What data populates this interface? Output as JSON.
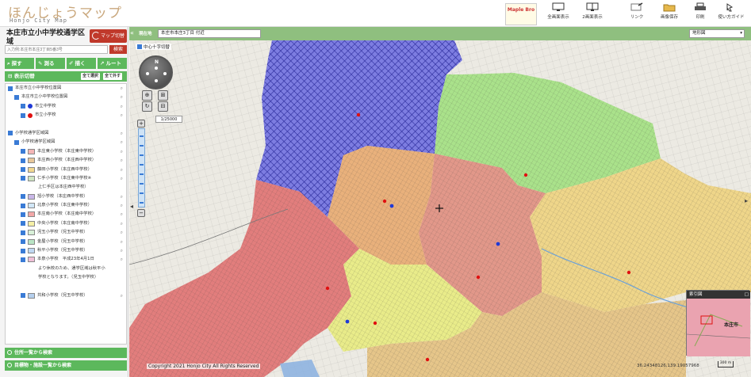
{
  "header": {
    "logo_title": "ほんじょうマップ",
    "logo_subtitle": "Honjo City Map",
    "maplebro_label": "Maple Bro",
    "tools": [
      {
        "label": "全画面表示",
        "icon": "monitor-icon"
      },
      {
        "label": "2画面表示",
        "icon": "dual-screen-icon"
      },
      {
        "label": "リンク",
        "icon": "link-icon"
      },
      {
        "label": "画像保存",
        "icon": "folder-save-icon"
      },
      {
        "label": "印刷",
        "icon": "printer-icon"
      },
      {
        "label": "使い方ガイド",
        "icon": "guide-icon"
      }
    ]
  },
  "left": {
    "title": "本庄市立小中学校通学区域",
    "map_switch": "マップ切替",
    "search_placeholder": "入力例:本庄市本庄3丁目5番3号",
    "search_button": "検索",
    "tabs": [
      "探す",
      "測る",
      "描く",
      "ルート"
    ],
    "layer_header": "表示切替",
    "layer_buttons": [
      "全て選択",
      "全て外す"
    ],
    "layers": [
      {
        "label": "本庄市立小中学校位置図",
        "indent": 0,
        "checked": true,
        "kind": "group"
      },
      {
        "label": "本庄市立小中学校位置図",
        "indent": 1,
        "checked": true,
        "kind": "group"
      },
      {
        "label": "市立中学校",
        "indent": 2,
        "checked": true,
        "kind": "dot",
        "color": "#1f3ad6"
      },
      {
        "label": "市立小学校",
        "indent": 2,
        "checked": true,
        "kind": "dot",
        "color": "#e01010"
      },
      {
        "label": "",
        "indent": 0,
        "checked": false,
        "kind": "spacer"
      },
      {
        "label": "小学校通学区域図",
        "indent": 0,
        "checked": true,
        "kind": "group"
      },
      {
        "label": "小学校通学区域図",
        "indent": 1,
        "checked": true,
        "kind": "group"
      },
      {
        "label": "本庄東小学校（本庄東中学校）",
        "indent": 2,
        "checked": true,
        "kind": "swatch",
        "color": "#f4b6b6"
      },
      {
        "label": "本庄西小学校（本庄西中学校）",
        "indent": 2,
        "checked": true,
        "kind": "swatch",
        "color": "#e8c79a"
      },
      {
        "label": "藤田小学校（本庄西中学校）",
        "indent": 2,
        "checked": true,
        "kind": "swatch",
        "color": "#f2d88f"
      },
      {
        "label": "仁手小学校（本庄東中学校※",
        "indent": 2,
        "checked": true,
        "kind": "swatch",
        "color": "#cfe6c2"
      },
      {
        "label": "上仁手区は本庄西中学校）",
        "indent": 3,
        "checked": false,
        "kind": "text"
      },
      {
        "label": "旭小学校（本庄西中学校）",
        "indent": 2,
        "checked": true,
        "kind": "swatch",
        "color": "#c9b7e8"
      },
      {
        "label": "北泉小学校（本庄東中学校）",
        "indent": 2,
        "checked": true,
        "kind": "swatch",
        "color": "#d2e7f7"
      },
      {
        "label": "本庄南小学校（本庄南中学校）",
        "indent": 2,
        "checked": true,
        "kind": "swatch",
        "color": "#f2a7a7"
      },
      {
        "label": "中央小学校（本庄南中学校）",
        "indent": 2,
        "checked": true,
        "kind": "swatch",
        "color": "#f6f0a6"
      },
      {
        "label": "児玉小学校（児玉中学校）",
        "indent": 2,
        "checked": true,
        "kind": "swatch",
        "color": "#d8f0d8"
      },
      {
        "label": "金屋小学校（児玉中学校）",
        "indent": 2,
        "checked": true,
        "kind": "swatch",
        "color": "#b9e4c4"
      },
      {
        "label": "秋平小学校（児玉中学校）",
        "indent": 2,
        "checked": true,
        "kind": "swatch",
        "color": "#c0d8f2"
      },
      {
        "label": "本泉小学校　平成23年4月1日",
        "indent": 2,
        "checked": true,
        "kind": "swatch",
        "color": "#f0c0d8"
      },
      {
        "label": "より休校のため、通学区域は秋平小",
        "indent": 3,
        "checked": false,
        "kind": "text"
      },
      {
        "label": "学校となります。（児玉中学校）",
        "indent": 3,
        "checked": false,
        "kind": "text"
      },
      {
        "label": "",
        "indent": 0,
        "checked": false,
        "kind": "spacer"
      },
      {
        "label": "共和小学校（児玉中学校）",
        "indent": 2,
        "checked": true,
        "kind": "swatch",
        "color": "#b6d0ee"
      }
    ],
    "bottom_buttons": [
      "住所一覧から検索",
      "目標物・施設一覧から検索"
    ]
  },
  "map": {
    "location_label": "現在地",
    "address": "本庄市本庄3丁目 付近",
    "basemap_select": "地形図",
    "overlay_label": "中心十字切替",
    "scale": "1/25000",
    "minimap_title": "索引図",
    "minimap_place": "本庄市",
    "copyright": "Copyright 2021 Honjo City All Rights Reserved",
    "coordinates": "36.24348126,139.19057968",
    "scale_bar": "300 m"
  }
}
